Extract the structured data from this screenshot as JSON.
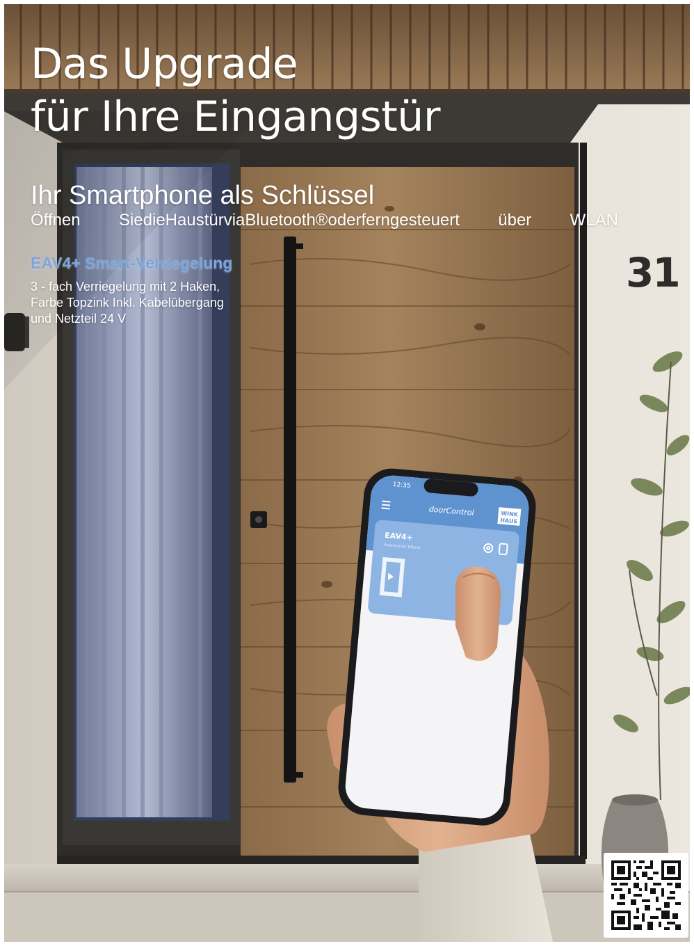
{
  "headline": {
    "line1": "Das Upgrade",
    "line2": "für Ihre Eingangstür"
  },
  "subheadline": "Ihr Smartphone als Schlüssel",
  "tagline": {
    "words": [
      "Öffnen",
      "SiedieHaustürviaBluetooth®oderferngesteuert",
      "über",
      "WLAN"
    ]
  },
  "product": {
    "name": "EAV4+ Smart-Verriegelung",
    "desc_line1": " 3 - fach Verriegelung mit 2 Haken,",
    "desc_line2": "Farbe Topzink Inkl. Kabelübergang",
    "desc_line3": "und Netzteil 24 V"
  },
  "house_number": "31",
  "phone": {
    "time": "12:35",
    "app_title": "doorControl",
    "brand_line1": "WINK",
    "brand_line2": "HAUS",
    "device_name": "EAV4+",
    "device_sub": "Anwesend: Eltern"
  },
  "colors": {
    "accent_blue": "#7aa6dc",
    "card_blue": "#8db4e2",
    "text_white": "#ffffff"
  },
  "icons": [
    "menu-icon",
    "gear-icon",
    "battery-icon",
    "door-icon",
    "qr-code"
  ]
}
